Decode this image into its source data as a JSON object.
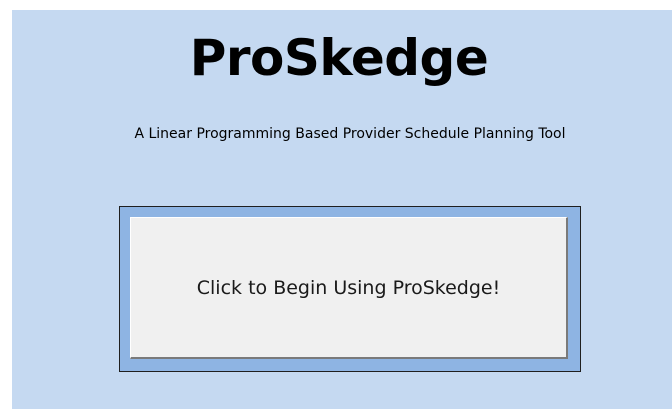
{
  "app": {
    "title": "ProSkedge",
    "subtitle": "A Linear Programming Based Provider Schedule Planning Tool"
  },
  "start_button": {
    "label": "Click to Begin Using ProSkedge!"
  },
  "colors": {
    "panel_background": "#c5d9f1",
    "button_frame": "#8eb4e3",
    "button_face": "#f0f0f0"
  }
}
